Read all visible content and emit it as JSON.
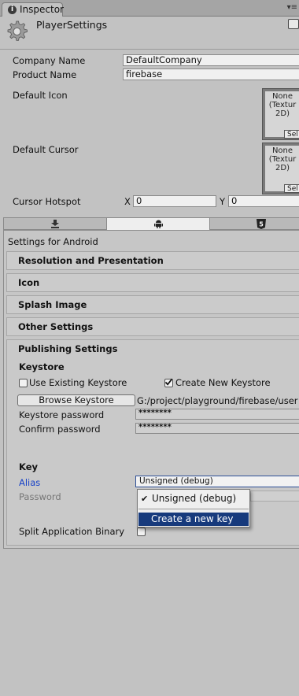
{
  "window": {
    "tab_label": "Inspector",
    "menu_glyph": "▾≡"
  },
  "header": {
    "title": "PlayerSettings",
    "help_glyph": "?"
  },
  "fields": {
    "company_name": {
      "label": "Company Name",
      "value": "DefaultCompany"
    },
    "product_name": {
      "label": "Product Name",
      "value": "firebase"
    },
    "default_icon": {
      "label": "Default Icon",
      "object_text": "None\n(Textur\n2D)",
      "select_label": "Sel"
    },
    "default_cursor": {
      "label": "Default Cursor",
      "object_text": "None\n(Textur\n2D)",
      "select_label": "Sel"
    },
    "cursor_hotspot": {
      "label": "Cursor Hotspot",
      "x_label": "X",
      "x_value": "0",
      "y_label": "Y",
      "y_value": "0"
    }
  },
  "platform_tabs": {
    "standalone_icon": "download-icon",
    "android_icon": "android-icon",
    "webgl_icon": "html5-icon",
    "webgl_glyph": "5"
  },
  "settings_for": "Settings for Android",
  "sections": {
    "resolution": "Resolution and Presentation",
    "icon": "Icon",
    "splash": "Splash Image",
    "other": "Other Settings",
    "publishing": "Publishing Settings"
  },
  "keystore": {
    "heading": "Keystore",
    "use_existing_label": "Use Existing Keystore",
    "use_existing_checked": false,
    "create_new_label": "Create New Keystore",
    "create_new_checked": true,
    "browse_label": "Browse Keystore",
    "path": "G:/project/playground/firebase/user",
    "password_label": "Keystore password",
    "password_value": "********",
    "confirm_label": "Confirm password",
    "confirm_value": "********"
  },
  "key": {
    "heading": "Key",
    "alias_label": "Alias",
    "alias_value": "Unsigned (debug)",
    "password_label": "Password",
    "split_label": "Split Application Binary",
    "split_checked": false
  },
  "popup": {
    "items": [
      {
        "label": "Unsigned (debug)",
        "checked": true
      },
      {
        "label": "Create a new key",
        "checked": false,
        "highlighted": true
      }
    ],
    "check_glyph": "✔"
  },
  "colors": {
    "highlight": "#173a7c",
    "alias_label": "#1a44c8",
    "background": "#c2c2c2"
  }
}
